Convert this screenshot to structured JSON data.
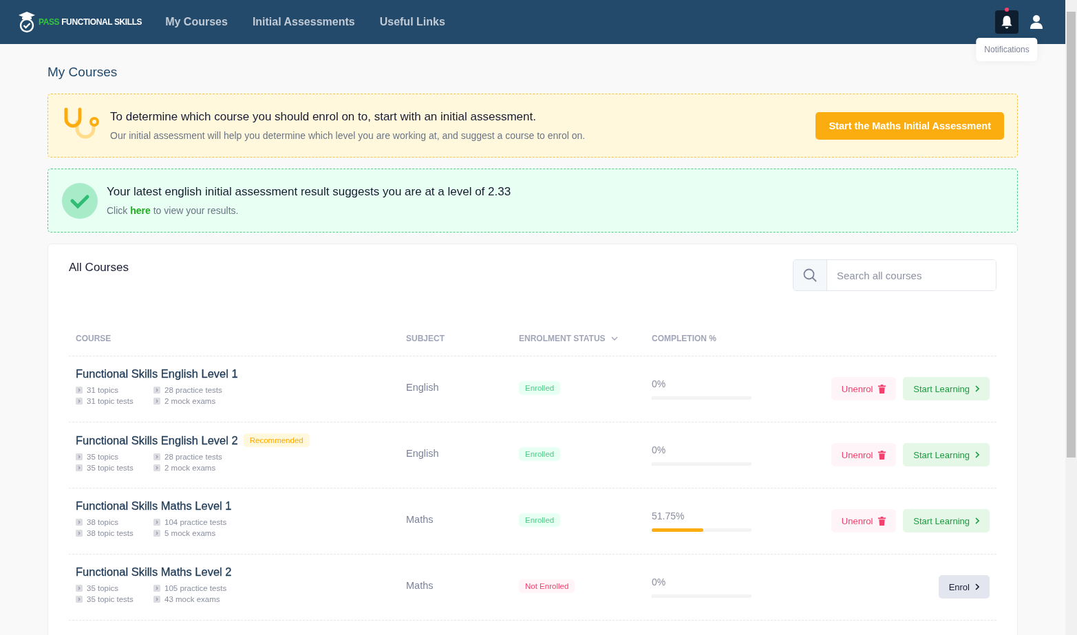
{
  "nav": {
    "logo": {
      "accent": "PASS",
      "rest": "FUNCTIONAL SKILLS"
    },
    "links": [
      {
        "label": "My Courses"
      },
      {
        "label": "Initial Assessments"
      },
      {
        "label": "Useful Links"
      }
    ],
    "notification_unread": true,
    "tooltip": "Notifications"
  },
  "page_title": "My Courses",
  "assessment_banner": {
    "title": "To determine which course you should enrol on to, start with an initial assessment.",
    "text": "Our initial assessment will help you determine which level you are working at, and suggest a course to enrol on.",
    "button": "Start the Maths Initial Assessment"
  },
  "result_banner": {
    "title": "Your latest english initial assessment result suggests you are at a level of 2.33",
    "before": "Click ",
    "link": "here",
    "after": " to view your results."
  },
  "courses_card": {
    "title": "All Courses",
    "search": {
      "placeholder": "Search all courses"
    },
    "columns": [
      {
        "label": "COURSE",
        "sortable": false
      },
      {
        "label": "SUBJECT",
        "sortable": false
      },
      {
        "label": "ENROLMENT STATUS",
        "sortable": true
      },
      {
        "label": "COMPLETION %",
        "sortable": false
      }
    ],
    "rows": [
      {
        "title": "Functional Skills English Level 1",
        "badge": null,
        "stats": [
          "31 topics",
          "28 practice tests",
          "31 topic tests",
          "2 mock exams"
        ],
        "subject": "English",
        "status": {
          "label": "Enrolled",
          "kind": "enrolled"
        },
        "completion": "0%",
        "level": 0,
        "actions": [
          {
            "label": "Unenrol",
            "kind": "unenrol"
          },
          {
            "label": "Start Learning",
            "kind": "start"
          }
        ]
      },
      {
        "title": "Functional Skills English Level 2",
        "badge": "Recommended",
        "stats": [
          "35 topics",
          "28 practice tests",
          "35 topic tests",
          "2 mock exams"
        ],
        "subject": "English",
        "status": {
          "label": "Enrolled",
          "kind": "enrolled"
        },
        "completion": "0%",
        "level": 0,
        "actions": [
          {
            "label": "Unenrol",
            "kind": "unenrol"
          },
          {
            "label": "Start Learning",
            "kind": "start"
          }
        ]
      },
      {
        "title": "Functional Skills Maths Level 1",
        "badge": null,
        "stats": [
          "38 topics",
          "104 practice tests",
          "38 topic tests",
          "5 mock exams"
        ],
        "subject": "Maths",
        "status": {
          "label": "Enrolled",
          "kind": "enrolled"
        },
        "completion": "51.75%",
        "level": 0.52,
        "actions": [
          {
            "label": "Unenrol",
            "kind": "unenrol"
          },
          {
            "label": "Start Learning",
            "kind": "start"
          }
        ]
      },
      {
        "title": "Functional Skills Maths Level 2",
        "badge": null,
        "stats": [
          "35 topics",
          "105 practice tests",
          "35 topic tests",
          "43 mock exams"
        ],
        "subject": "Maths",
        "status": {
          "label": "Not Enrolled",
          "kind": "not_enrolled"
        },
        "completion": "0%",
        "level": 0,
        "actions": [
          {
            "label": "Enrol",
            "kind": "enrol"
          }
        ]
      }
    ]
  }
}
